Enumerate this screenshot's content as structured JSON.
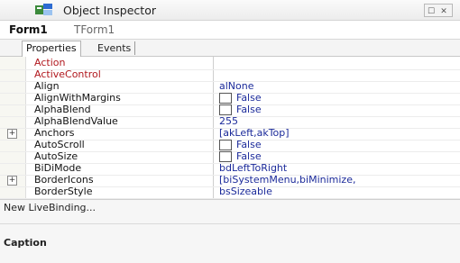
{
  "window": {
    "title": "Object Inspector",
    "buttons": [
      "☐",
      "✕"
    ]
  },
  "selector": {
    "component_name": "Form1",
    "component_type": "TForm1"
  },
  "tabs": [
    {
      "label": "Properties",
      "active": true
    },
    {
      "label": "Events",
      "active": false
    }
  ],
  "properties": [
    {
      "name": "Action",
      "value": "",
      "kind": "event",
      "expandable": false
    },
    {
      "name": "ActiveControl",
      "value": "",
      "kind": "event",
      "expandable": false
    },
    {
      "name": "Align",
      "value": "alNone",
      "kind": "text",
      "expandable": false
    },
    {
      "name": "AlignWithMargins",
      "value": "False",
      "kind": "bool",
      "expandable": false
    },
    {
      "name": "AlphaBlend",
      "value": "False",
      "kind": "bool",
      "expandable": false
    },
    {
      "name": "AlphaBlendValue",
      "value": "255",
      "kind": "text",
      "expandable": false
    },
    {
      "name": "Anchors",
      "value": "[akLeft,akTop]",
      "kind": "text",
      "expandable": true
    },
    {
      "name": "AutoScroll",
      "value": "False",
      "kind": "bool",
      "expandable": false
    },
    {
      "name": "AutoSize",
      "value": "False",
      "kind": "bool",
      "expandable": false
    },
    {
      "name": "BiDiMode",
      "value": "bdLeftToRight",
      "kind": "text",
      "expandable": false
    },
    {
      "name": "BorderIcons",
      "value": "[biSystemMenu,biMinimize,",
      "kind": "text",
      "expandable": true
    },
    {
      "name": "BorderStyle",
      "value": "bsSizeable",
      "kind": "text",
      "expandable": false
    }
  ],
  "expander_symbol": "+",
  "binding_link": "New LiveBinding...",
  "help": {
    "title": "Caption"
  },
  "colors": {
    "event_name": "#b1181e",
    "value_text": "#1b2a9a"
  }
}
